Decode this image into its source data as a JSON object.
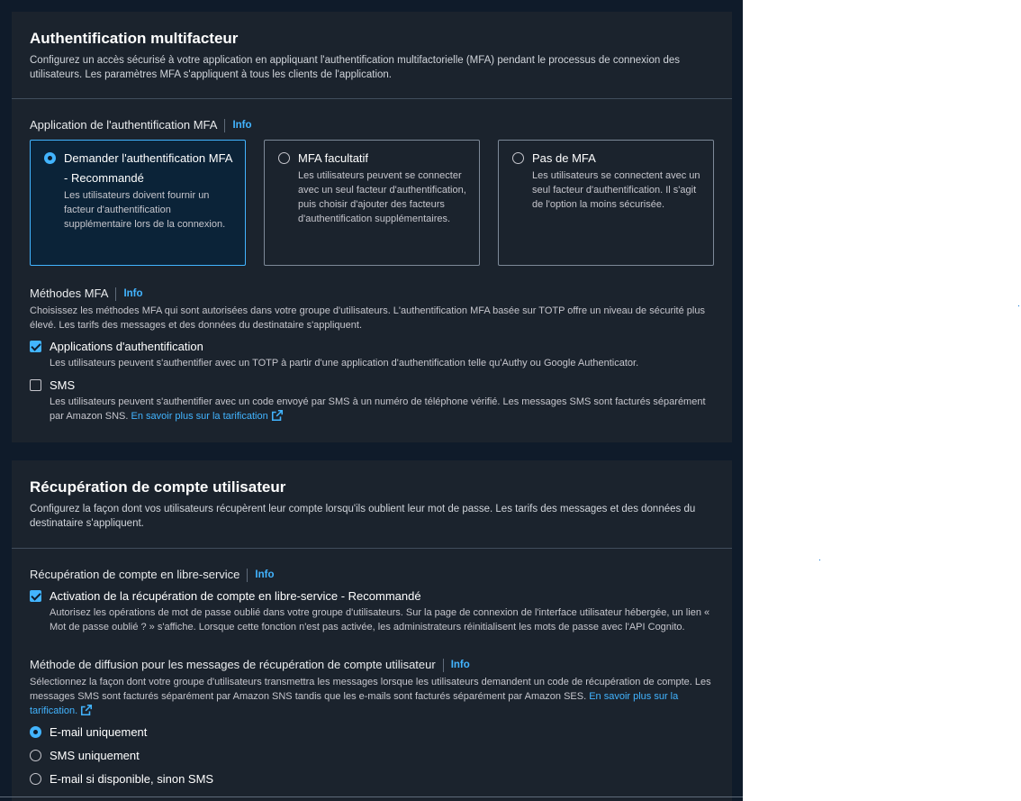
{
  "mfa": {
    "title": "Authentification multifacteur",
    "description": "Configurez un accès sécurisé à votre application en appliquant l'authentification multifactorielle (MFA) pendant le processus de connexion des utilisateurs. Les paramètres MFA s'appliquent à tous les clients de l'application.",
    "enforcement_label": "Application de l'authentification MFA",
    "info_label": "Info",
    "tiles": [
      {
        "title": "Demander l'authentification MFA - Recommandé",
        "description": "Les utilisateurs doivent fournir un facteur d'authentification supplémentaire lors de la connexion.",
        "selected": true
      },
      {
        "title": "MFA facultatif",
        "description": "Les utilisateurs peuvent se connecter avec un seul facteur d'authentification, puis choisir d'ajouter des facteurs d'authentification supplémentaires.",
        "selected": false
      },
      {
        "title": "Pas de MFA",
        "description": "Les utilisateurs se connectent avec un seul facteur d'authentification. Il s'agit de l'option la moins sécurisée.",
        "selected": false
      }
    ],
    "methods_label": "Méthodes MFA",
    "methods_description": "Choisissez les méthodes MFA qui sont autorisées dans votre groupe d'utilisateurs. L'authentification MFA basée sur TOTP offre un niveau de sécurité plus élevé. Les tarifs des messages et des données du destinataire s'appliquent.",
    "methods": [
      {
        "title": "Applications d'authentification",
        "description": "Les utilisateurs peuvent s'authentifier avec un TOTP à partir d'une application d'authentification telle qu'Authy ou Google Authenticator.",
        "checked": true
      },
      {
        "title": "SMS",
        "description": "Les utilisateurs peuvent s'authentifier avec un code envoyé par SMS à un numéro de téléphone vérifié. Les messages SMS sont facturés séparément par Amazon SNS.",
        "link": "En savoir plus sur la tarification",
        "checked": false
      }
    ]
  },
  "recovery": {
    "title": "Récupération de compte utilisateur",
    "description": "Configurez la façon dont vos utilisateurs récupèrent leur compte lorsqu'ils oublient leur mot de passe. Les tarifs des messages et des données du destinataire s'appliquent.",
    "self_service_label": "Récupération de compte en libre-service",
    "info_label": "Info",
    "self_service_option": {
      "title": "Activation de la récupération de compte en libre-service - Recommandé",
      "description": "Autorisez les opérations de mot de passe oublié dans votre groupe d'utilisateurs. Sur la page de connexion de l'interface utilisateur hébergée, un lien « Mot de passe oublié ? » s'affiche. Lorsque cette fonction n'est pas activée, les administrateurs réinitialisent les mots de passe avec l'API Cognito.",
      "checked": true
    },
    "delivery_label": "Méthode de diffusion pour les messages de récupération de compte utilisateur",
    "delivery_description": "Sélectionnez la façon dont votre groupe d'utilisateurs transmettra les messages lorsque les utilisateurs demandent un code de récupération de compte. Les messages SMS sont facturés séparément par Amazon SNS tandis que les e-mails sont facturés séparément par Amazon SES.",
    "delivery_link": "En savoir plus sur la tarification.",
    "delivery_options": [
      {
        "label": "E-mail uniquement",
        "selected": true
      },
      {
        "label": "SMS uniquement",
        "selected": false
      },
      {
        "label": "E-mail si disponible, sinon SMS",
        "selected": false
      }
    ]
  },
  "colors": {
    "accent": "#42b4ff",
    "container_bg": "#1b232d",
    "page_bg": "#0f1b2a"
  },
  "icons": {
    "external_link": "external-link-icon"
  }
}
